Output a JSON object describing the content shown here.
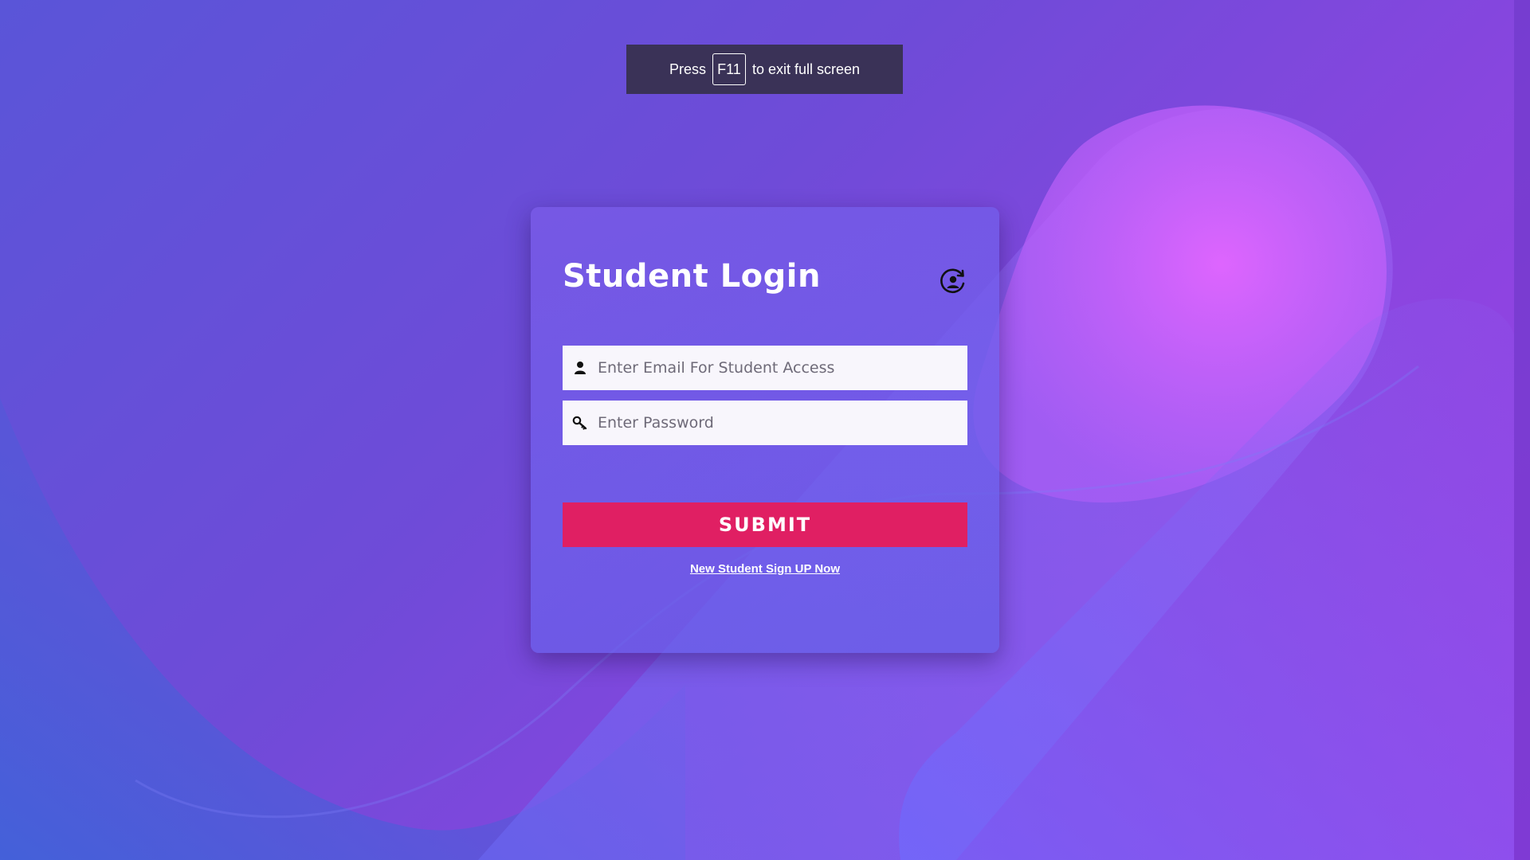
{
  "fullscreen_toast": {
    "prefix": "Press",
    "key": "F11",
    "suffix": "to exit full screen"
  },
  "login": {
    "title": "Student Login",
    "email_placeholder": "Enter Email For Student Access",
    "password_placeholder": "Enter Password",
    "submit_label": "SUBMIT",
    "signup_link": "New Student Sign UP Now"
  },
  "icons": {
    "header": "user-refresh-icon",
    "email": "user-icon",
    "password": "key-icon"
  },
  "colors": {
    "submit": "#e01f63",
    "toast": "#3a3257"
  }
}
